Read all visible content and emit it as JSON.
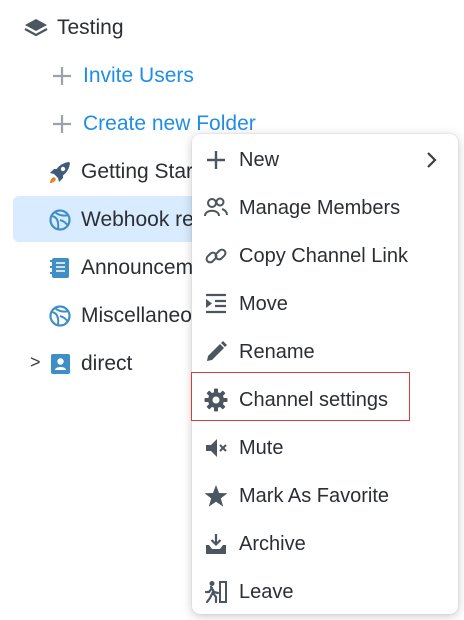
{
  "tree": {
    "workspace": {
      "label": "Testing",
      "icon": "layers-icon"
    },
    "actions": [
      {
        "label": "Invite Users",
        "icon": "plus-icon"
      },
      {
        "label": "Create new Folder",
        "icon": "plus-icon"
      }
    ],
    "channels": [
      {
        "label": "Getting Started",
        "icon": "rocket-icon"
      },
      {
        "label": "Webhook receiver",
        "icon": "globe-icon",
        "selected": true
      },
      {
        "label": "Announcements",
        "icon": "notebook-icon"
      },
      {
        "label": "Miscellaneous",
        "icon": "globe-icon"
      }
    ],
    "direct": {
      "label": "direct",
      "icon": "contact-book-icon",
      "expander": ">"
    }
  },
  "context_menu": {
    "items": [
      {
        "label": "New",
        "icon": "plus-icon",
        "submenu": true
      },
      {
        "label": "Manage Members",
        "icon": "members-icon"
      },
      {
        "label": "Copy Channel Link",
        "icon": "link-icon"
      },
      {
        "label": "Move",
        "icon": "move-icon"
      },
      {
        "label": "Rename",
        "icon": "pencil-icon"
      },
      {
        "label": "Channel settings",
        "icon": "gear-icon",
        "highlighted": true
      },
      {
        "label": "Mute",
        "icon": "mute-icon"
      },
      {
        "label": "Mark As Favorite",
        "icon": "star-icon"
      },
      {
        "label": "Archive",
        "icon": "archive-icon"
      },
      {
        "label": "Leave",
        "icon": "leave-icon"
      }
    ]
  },
  "colors": {
    "link_blue": "#1f8ee6",
    "selected_bg": "#d9ecff",
    "highlight_border": "#d93a3a",
    "channel_icon_blue": "#3f8fc6",
    "rocket_orange": "#ef7d22"
  }
}
